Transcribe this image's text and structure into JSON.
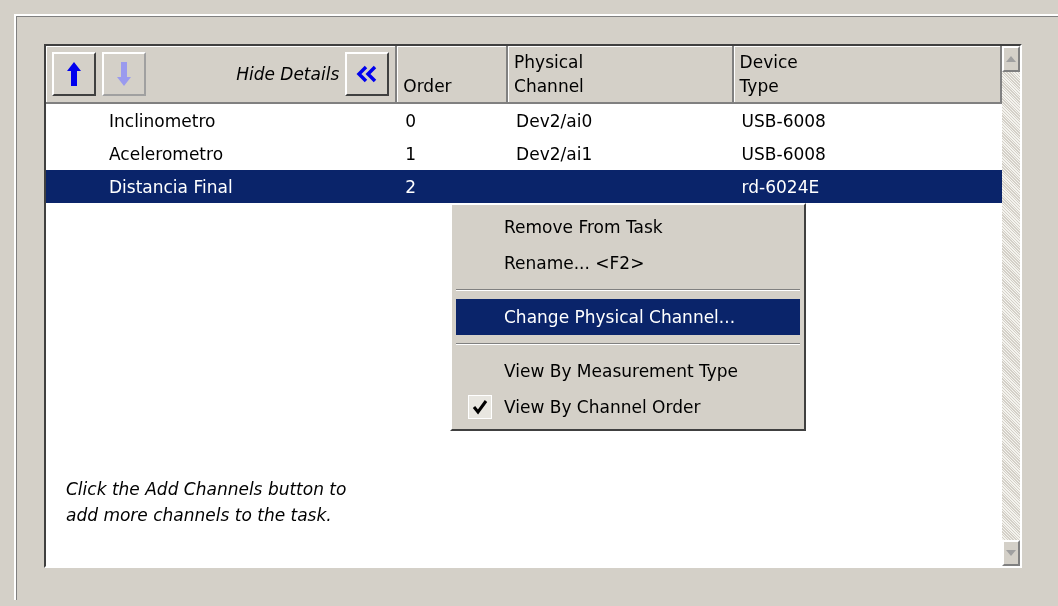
{
  "toolbar": {
    "buttons": [
      {
        "kind": "up",
        "disabled": false
      },
      {
        "kind": "down",
        "disabled": true
      }
    ],
    "hide_details_label": "Hide Details"
  },
  "table": {
    "columns": [
      {
        "lines": [
          "Order"
        ]
      },
      {
        "lines": [
          "Physical",
          "Channel"
        ]
      },
      {
        "lines": [
          "Device",
          "Type"
        ]
      }
    ],
    "rows": [
      {
        "name": "Inclinometro",
        "order": "0",
        "physical_channel": "Dev2/ai0",
        "device_type": "USB-6008",
        "selected": false
      },
      {
        "name": "Acelerometro",
        "order": "1",
        "physical_channel": "Dev2/ai1",
        "device_type": "USB-6008",
        "selected": false
      },
      {
        "name": "Distancia Final",
        "order": "2",
        "device_type": "rd-6024E",
        "selected": true
      }
    ]
  },
  "hint": "Click the Add Channels button to\nadd more channels to the task.",
  "context_menu": [
    {
      "kind": "item",
      "label": "Remove From Task",
      "selected": false,
      "checked": false
    },
    {
      "kind": "item",
      "label": "Rename... <F2>",
      "selected": false,
      "checked": false
    },
    {
      "kind": "separator"
    },
    {
      "kind": "item",
      "label": "Change Physical Channel...",
      "selected": true,
      "checked": false
    },
    {
      "kind": "separator"
    },
    {
      "kind": "item",
      "label": "View By Measurement Type",
      "selected": false,
      "checked": false
    },
    {
      "kind": "item",
      "label": "View By Channel Order",
      "selected": false,
      "checked": true
    }
  ]
}
